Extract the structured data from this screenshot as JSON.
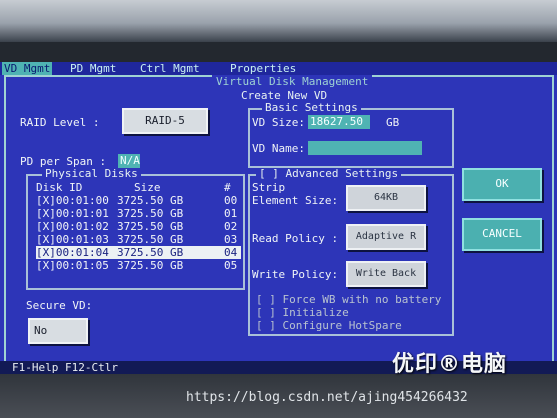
{
  "menu": {
    "items": [
      {
        "label": "VD Mgmt"
      },
      {
        "label": "PD Mgmt"
      },
      {
        "label": "Ctrl Mgmt"
      },
      {
        "label": "Properties"
      }
    ]
  },
  "dialog": {
    "outer_title": "Virtual Disk Management",
    "title": "Create New VD",
    "raid_level_label": "RAID Level :",
    "raid_level_value": "RAID-5",
    "pd_per_span_label": "PD per Span :",
    "pd_per_span_value": "N/A",
    "physical_disks": {
      "title": "Physical Disks",
      "columns": {
        "disk_id": "Disk ID",
        "size": "Size",
        "num": "#"
      },
      "rows": [
        {
          "id": "[X]00:01:00",
          "size": "3725.50 GB",
          "num": "00",
          "selected": false
        },
        {
          "id": "[X]00:01:01",
          "size": "3725.50 GB",
          "num": "01",
          "selected": false
        },
        {
          "id": "[X]00:01:02",
          "size": "3725.50 GB",
          "num": "02",
          "selected": false
        },
        {
          "id": "[X]00:01:03",
          "size": "3725.50 GB",
          "num": "03",
          "selected": false
        },
        {
          "id": "[X]00:01:04",
          "size": "3725.50 GB",
          "num": "04",
          "selected": true
        },
        {
          "id": "[X]00:01:05",
          "size": "3725.50 GB",
          "num": "05",
          "selected": false
        }
      ]
    },
    "basic_settings": {
      "title": "Basic Settings",
      "vd_size_label": "VD Size:",
      "vd_size_value": "18627.50",
      "vd_size_unit": "GB",
      "vd_name_label": "VD Name:",
      "vd_name_value": ""
    },
    "advanced_settings": {
      "title": "[ ] Advanced Settings",
      "strip_label_1": "Strip",
      "strip_label_2": "Element Size:",
      "strip_value": "64KB",
      "read_policy_label": "Read Policy :",
      "read_policy_value": "Adaptive R",
      "write_policy_label": "Write Policy:",
      "write_policy_value": "Write Back",
      "checkbox_1": "[ ] Force WB with no battery",
      "checkbox_2": "[ ] Initialize",
      "checkbox_3": "[ ] Configure HotSpare"
    },
    "secure_vd_label": "Secure VD:",
    "secure_vd_value": "No",
    "ok_label": "OK",
    "cancel_label": "CANCEL"
  },
  "status_bar": {
    "text": "F1-Help F12-Ctlr"
  },
  "watermark": {
    "logo_text": "优印®电脑",
    "url": "https://blog.csdn.net/ajing454266432"
  }
}
